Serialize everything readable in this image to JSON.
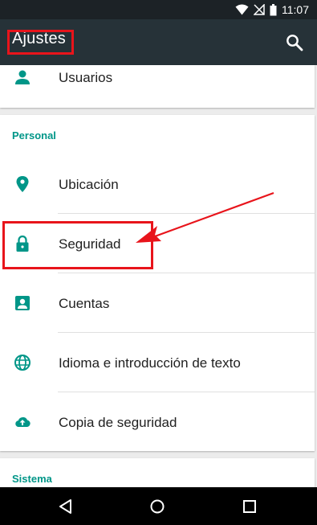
{
  "status_bar": {
    "time": "11:07"
  },
  "toolbar": {
    "title": "Ajustes",
    "search_icon": "search-icon"
  },
  "top_item": {
    "label": "Usuarios",
    "icon": "person-icon"
  },
  "personal": {
    "header": "Personal",
    "items": [
      {
        "label": "Ubicación",
        "icon": "location-pin-icon"
      },
      {
        "label": "Seguridad",
        "icon": "lock-icon"
      },
      {
        "label": "Cuentas",
        "icon": "account-box-icon"
      },
      {
        "label": "Idioma e introducción de texto",
        "icon": "globe-icon"
      },
      {
        "label": "Copia de seguridad",
        "icon": "cloud-upload-icon"
      }
    ]
  },
  "sistema": {
    "header": "Sistema"
  },
  "colors": {
    "accent": "#009688",
    "toolbar": "#263238",
    "annotation": "#e8141b"
  }
}
